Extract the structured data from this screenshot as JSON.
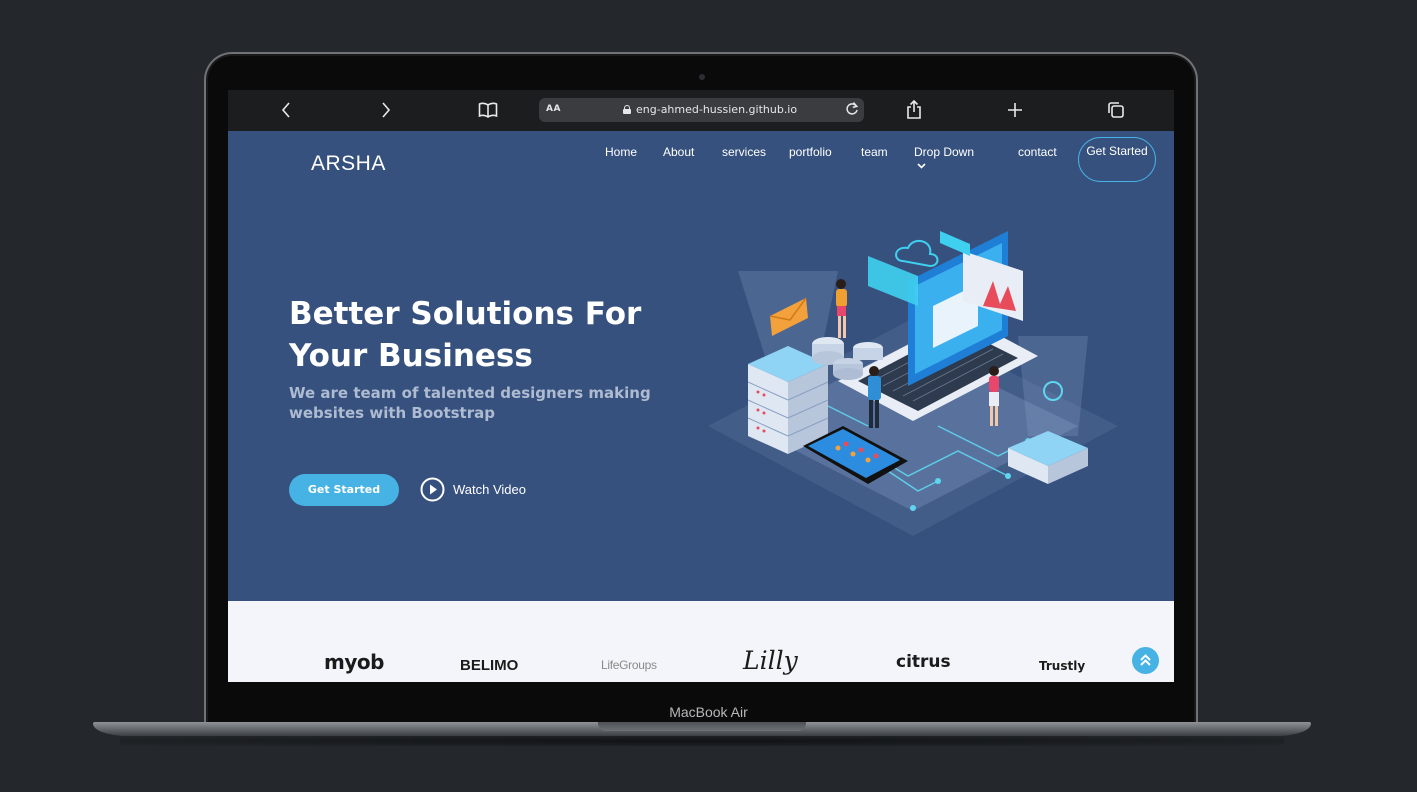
{
  "device": {
    "label": "MacBook Air"
  },
  "browser": {
    "text_size_label": "AA",
    "url": "eng-ahmed-hussien.github.io"
  },
  "site": {
    "logo": "ARSHA",
    "nav": [
      "Home",
      "About",
      "services",
      "portfolio",
      "team",
      "Drop Down",
      "contact"
    ],
    "cta_label": "Get Started",
    "hero_title": "Better Solutions For Your Business",
    "hero_subtitle": "We are team of talented designers making websites with Bootstrap",
    "primary_button": "Get Started",
    "watch_video": "Watch Video",
    "clients": [
      "myob",
      "BELIMO",
      "LifeGroups",
      "Lilly",
      "citrus",
      "Trustly"
    ]
  },
  "colors": {
    "hero_bg": "#37517e",
    "accent": "#47b2e4",
    "clients_bg": "#f3f5fa",
    "page_bg": "#24282c"
  },
  "icons": {
    "back": "chevron-left-icon",
    "forward": "chevron-right-icon",
    "bookmarks": "book-icon",
    "share": "share-icon",
    "new_tab": "plus-icon",
    "tabs": "tabs-icon",
    "reload": "reload-icon",
    "secure": "lock-icon",
    "play": "play-circle-icon",
    "back_to_top": "double-chevron-up-icon"
  }
}
